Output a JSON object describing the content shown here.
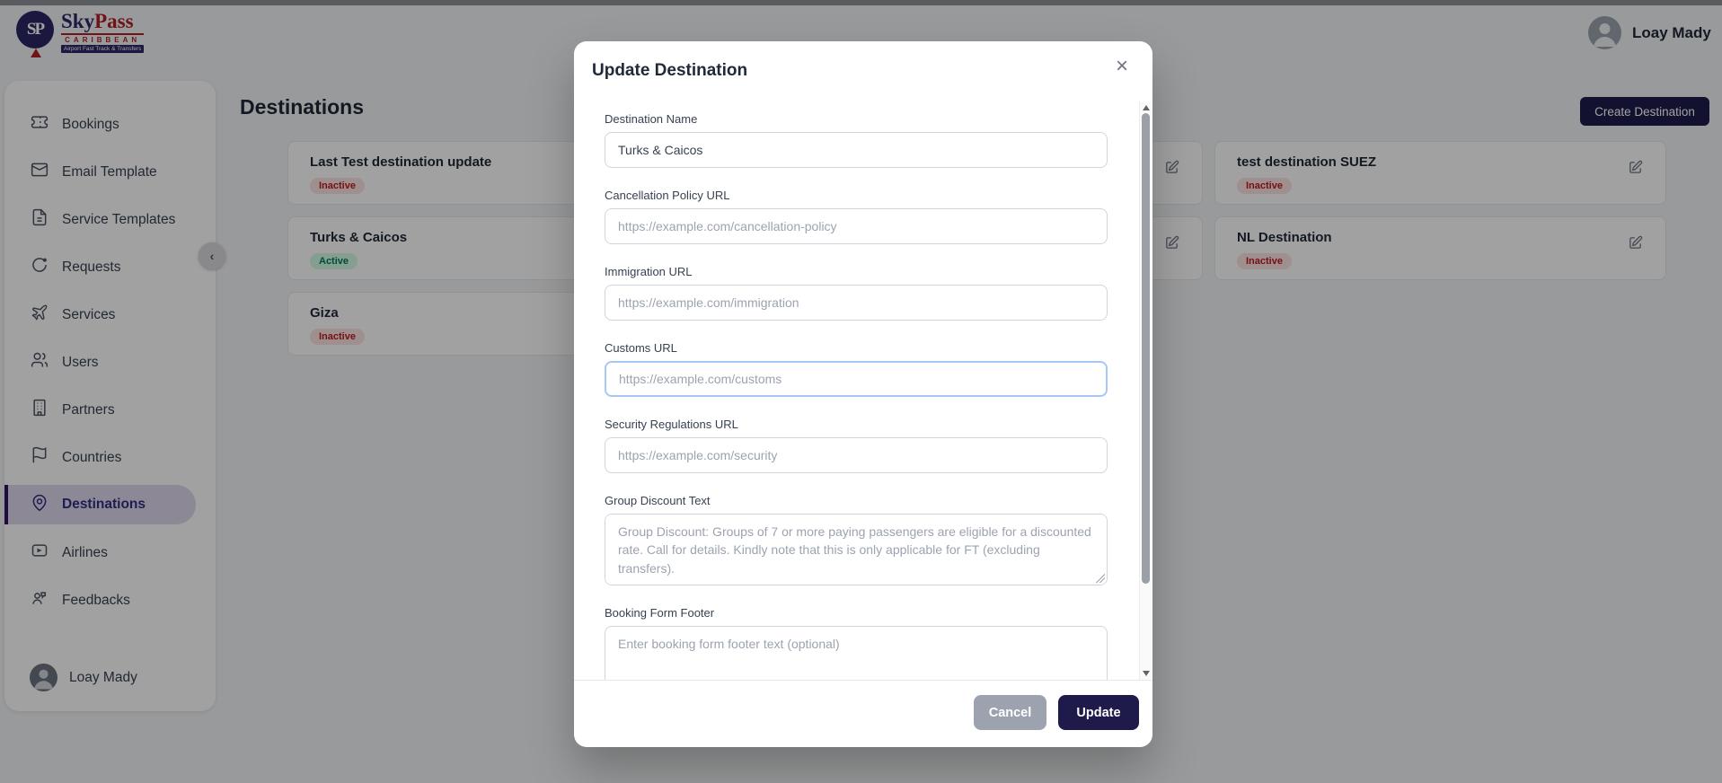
{
  "header": {
    "logo": {
      "monogram": "SP",
      "name_sky": "Sky",
      "name_pass": "Pass",
      "subtitle": "CARIBBEAN",
      "tagline": "Airport Fast Track & Transfers"
    },
    "user_name": "Loay Mady"
  },
  "sidebar": {
    "items": [
      {
        "label": "Bookings",
        "icon": "ticket-icon"
      },
      {
        "label": "Email Template",
        "icon": "mail-icon"
      },
      {
        "label": "Service Templates",
        "icon": "file-icon"
      },
      {
        "label": "Requests",
        "icon": "request-icon"
      },
      {
        "label": "Services",
        "icon": "plane-icon"
      },
      {
        "label": "Users",
        "icon": "users-icon"
      },
      {
        "label": "Partners",
        "icon": "building-icon"
      },
      {
        "label": "Countries",
        "icon": "flag-icon"
      },
      {
        "label": "Destinations",
        "icon": "map-pin-icon",
        "active": true
      },
      {
        "label": "Airlines",
        "icon": "send-icon"
      },
      {
        "label": "Feedbacks",
        "icon": "feedback-icon"
      }
    ],
    "footer_user": "Loay Mady",
    "collapse_glyph": "‹"
  },
  "page": {
    "title": "Destinations",
    "create_button": "Create Destination"
  },
  "cards": [
    {
      "name": "Last Test destination update",
      "status": "Inactive"
    },
    {
      "name": "",
      "status": ""
    },
    {
      "name": "test destination SUEZ",
      "status": "Inactive"
    },
    {
      "name": "Turks & Caicos",
      "status": "Active"
    },
    {
      "name": "",
      "status": ""
    },
    {
      "name": "NL Destination",
      "status": "Inactive"
    },
    {
      "name": "Giza",
      "status": "Inactive"
    }
  ],
  "modal": {
    "title": "Update Destination",
    "close_glyph": "×",
    "fields": [
      {
        "label": "Destination Name",
        "value": "Turks & Caicos",
        "placeholder": ""
      },
      {
        "label": "Cancellation Policy URL",
        "placeholder": "https://example.com/cancellation-policy"
      },
      {
        "label": "Immigration URL",
        "placeholder": "https://example.com/immigration"
      },
      {
        "label": "Customs URL",
        "placeholder": "https://example.com/customs",
        "focused": true
      },
      {
        "label": "Security Regulations URL",
        "placeholder": "https://example.com/security"
      },
      {
        "label": "Group Discount Text",
        "placeholder": "Group Discount: Groups of 7 or more paying passengers are eligible for a discounted rate. Call for details. Kindly note that this is only applicable for FT (excluding transfers)."
      },
      {
        "label": "Booking Form Footer",
        "placeholder": "Enter booking form footer text (optional)"
      }
    ],
    "footer": {
      "cancel": "Cancel",
      "update": "Update"
    }
  },
  "colors": {
    "accent": "#1e1b4b",
    "active_badge_bg": "#d1fae5",
    "active_badge_text": "#047857",
    "inactive_badge_bg": "#fee2e2",
    "inactive_badge_text": "#b91c1c",
    "focus_border": "#a6c8f7",
    "cancel_bg": "#9ca3af",
    "sidebar_active_bg": "#ded7ee",
    "sidebar_active_text": "#312e81"
  }
}
